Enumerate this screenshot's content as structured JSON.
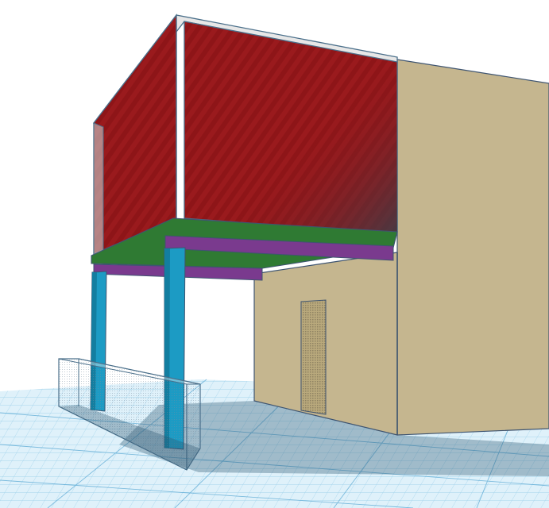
{
  "app": {
    "view": "3d-workplane-perspective"
  },
  "colors": {
    "background": "#ffffff",
    "workplane": "#d9eef9",
    "workplane_grid": "#6fb8de",
    "wall_beige": "#c5b68f",
    "wall_beige_dark": "#b6a67d",
    "upper_wall_red": "#8e1518",
    "floor_slab_green": "#2f7a33",
    "beam_purple": "#7a3a8e",
    "column_blue": "#1c9bc4",
    "glass_outline": "#4a6f8a",
    "shadow": "#2b5570"
  },
  "objects": [
    {
      "name": "ground-workplane",
      "shape": "grid-plane"
    },
    {
      "name": "building-main-box",
      "shape": "box"
    },
    {
      "name": "door",
      "shape": "box"
    },
    {
      "name": "upper-room-walls",
      "shape": "box"
    },
    {
      "name": "floor-slab",
      "shape": "box"
    },
    {
      "name": "support-beam",
      "shape": "box"
    },
    {
      "name": "support-column-front",
      "shape": "cylinder"
    },
    {
      "name": "support-column-back",
      "shape": "cylinder"
    },
    {
      "name": "railing-glass",
      "shape": "box"
    }
  ]
}
